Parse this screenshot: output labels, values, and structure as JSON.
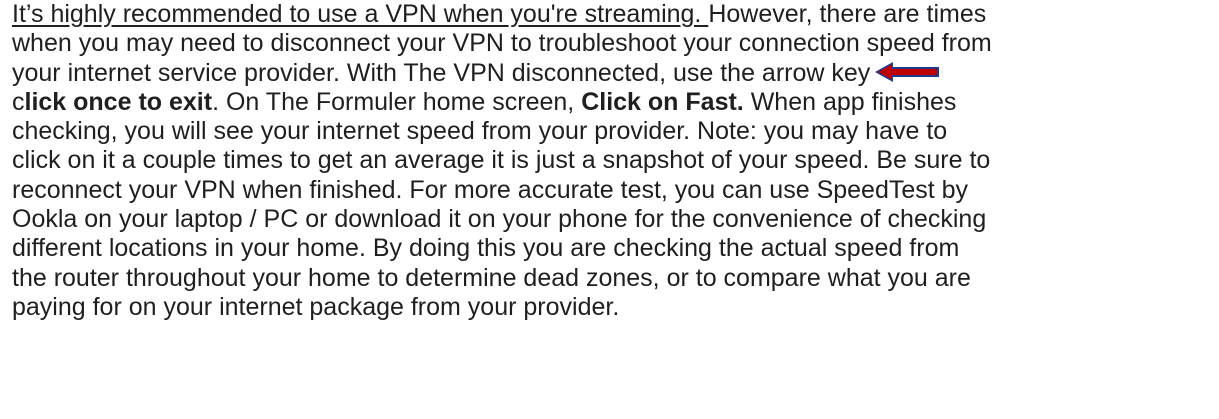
{
  "paragraph": {
    "l1_underlined": "It’s highly recommended to use a VPN when you're streaming. ",
    "l1_rest": "However, there are times",
    "l2": "when you may need to disconnect your VPN to troubleshoot your connection speed from",
    "l3": "your internet service provider. With The VPN disconnected, use the arrow key",
    "l4_c": "c",
    "l4_bold": "lick once to exit",
    "l4_mid": ". On The Formuler home screen, ",
    "l4_bold2": "Click on Fast.",
    "l4_rest": " When app finishes",
    "l5": "checking, you will see your internet speed from your provider. Note: you may have to",
    "l6": "click on it a couple times to get an average it is just a snapshot of your speed. Be sure to",
    "l7": "reconnect your VPN when finished. For more accurate test, you can use SpeedTest by",
    "l8": "Ookla on your laptop / PC or download it on your phone for the convenience of checking",
    "l9": "different locations in your home. By doing this you are checking the actual speed from",
    "l10": "the router throughout your home to determine dead zones, or to compare what you are",
    "l11": "paying for on your internet package from your provider."
  },
  "icons": {
    "arrow": "left-arrow-icon",
    "arrow_color": "#c00000",
    "arrow_outline": "#1f3b8a"
  }
}
